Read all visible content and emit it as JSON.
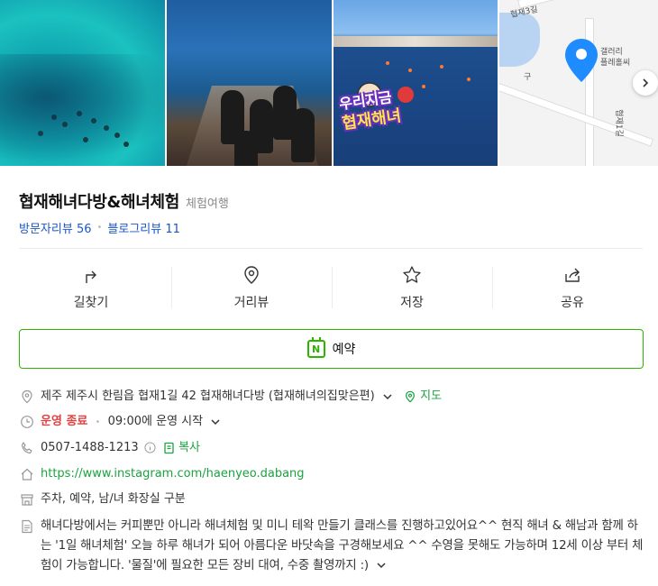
{
  "place": {
    "name": "협재해녀다방&해녀체험",
    "category": "체험여행",
    "visitor_review_label": "방문자리뷰",
    "visitor_review_count": "56",
    "blog_review_label": "블로그리뷰",
    "blog_review_count": "11"
  },
  "photos": {
    "badge_line1": "우리지금",
    "badge_line2": "협재해녀",
    "map_labels": [
      "협재3길",
      "갤러리",
      "플레홀씨",
      "구",
      "협재1길"
    ]
  },
  "actions": [
    {
      "label": "길찾기",
      "icon": "directions-icon"
    },
    {
      "label": "거리뷰",
      "icon": "location-pin-icon"
    },
    {
      "label": "저장",
      "icon": "star-icon"
    },
    {
      "label": "공유",
      "icon": "share-icon"
    }
  ],
  "reserve": {
    "label": "예약",
    "icon_letter": "N"
  },
  "info": {
    "address": "제주 제주시 한림읍 협재1길 42 협재해녀다방 (협재해녀의집맞은편)",
    "map_link": "지도",
    "status": "운영 종료",
    "hours": "09:00에 운영 시작",
    "phone": "0507-1488-1213",
    "copy_label": "복사",
    "website": "https://www.instagram.com/haenyeo.dabang",
    "amenities": "주차, 예약, 남/녀 화장실 구분",
    "description": "해녀다방에서는 커피뿐만 아니라 해녀체험 및 미니 테왁 만들기 클래스를 진행하고있어요^^ 현직 해녀 & 해남과 함께 하는 '1일 해녀체험' 오늘 하루 해녀가 되어 아름다운 바닷속을 구경해보세요 ^^ 수영을 못해도 가능하며 12세 이상 부터 체험이 가능합니다. '물질'에 필요한 모든 장비 대여, 수중 촬영까지 :)"
  },
  "colors": {
    "link_blue": "#1a56c4",
    "naver_green": "#2db400",
    "status_red": "#e34141",
    "pin_blue": "#1e8cff"
  }
}
